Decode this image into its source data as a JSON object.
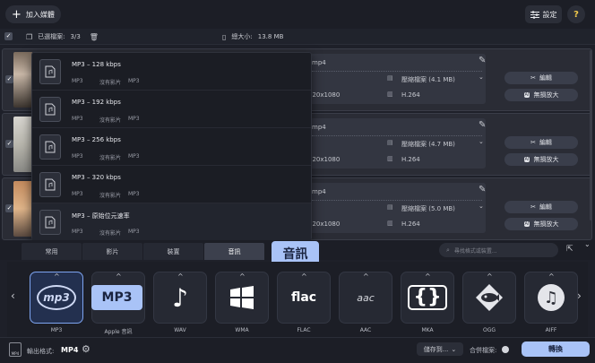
{
  "header": {
    "add_media_label": "加入媒體",
    "settings_label": "設定",
    "help_label": "?"
  },
  "selection": {
    "selected_label": "已選檔案:",
    "selected_count": "3/3",
    "total_size_label": "總大小:",
    "total_size_value": "13.8 MB"
  },
  "files": [
    {
      "format": "mp4",
      "resolution": "920x1080",
      "compress_label": "壓縮檔案 (4.1 MB)",
      "codec": "H.264",
      "edit_label": "編輯",
      "upscale_label": "無損放大"
    },
    {
      "format": "mp4",
      "resolution": "920x1080",
      "compress_label": "壓縮檔案 (4.7 MB)",
      "codec": "H.264",
      "edit_label": "編輯",
      "upscale_label": "無損放大"
    },
    {
      "format": "mp4",
      "resolution": "920x1080",
      "compress_label": "壓縮檔案 (5.0 MB)",
      "codec": "H.264",
      "edit_label": "編輯",
      "upscale_label": "無損放大"
    }
  ],
  "dropdown": {
    "items": [
      {
        "title": "MP3 – 128 kbps",
        "c1": "MP3",
        "c2": "沒有影片",
        "c3": "MP3"
      },
      {
        "title": "MP3 – 192 kbps",
        "c1": "MP3",
        "c2": "沒有影片",
        "c3": "MP3"
      },
      {
        "title": "MP3 – 256 kbps",
        "c1": "MP3",
        "c2": "沒有影片",
        "c3": "MP3"
      },
      {
        "title": "MP3 – 320 kbps",
        "c1": "MP3",
        "c2": "沒有影片",
        "c3": "MP3"
      },
      {
        "title": "MP3 – 原始位元速率",
        "c1": "MP3",
        "c2": "沒有影片",
        "c3": "MP3"
      }
    ]
  },
  "tabs": [
    "常用",
    "影片",
    "裝置",
    "音訊"
  ],
  "tooltips": {
    "audio": "音訊",
    "mp3": "MP3"
  },
  "search_placeholder": "尋找格式或裝置...",
  "formats": [
    {
      "label": "MP3",
      "icon": "mp3-icon"
    },
    {
      "label": "Apple 音訊",
      "icon": "music-note-icon"
    },
    {
      "label": "WAV",
      "icon": "wav-icon"
    },
    {
      "label": "WMA",
      "icon": "windows-icon"
    },
    {
      "label": "FLAC",
      "icon": "flac-icon"
    },
    {
      "label": "AAC",
      "icon": "aac-icon"
    },
    {
      "label": "MKA",
      "icon": "mka-icon"
    },
    {
      "label": "OGG",
      "icon": "ogg-icon"
    },
    {
      "label": "AIFF",
      "icon": "aiff-icon"
    }
  ],
  "format_icon_text": {
    "mp3": "mp3",
    "flac": "flac",
    "aac": "aac"
  },
  "bottom": {
    "output_label": "輸出格式:",
    "output_value": "MP4",
    "save_to_label": "儲存到...",
    "merge_label": "合併檔案:",
    "convert_label": "轉換"
  },
  "colors": {
    "accent": "#a9c3f7",
    "background": "#1e2029"
  }
}
